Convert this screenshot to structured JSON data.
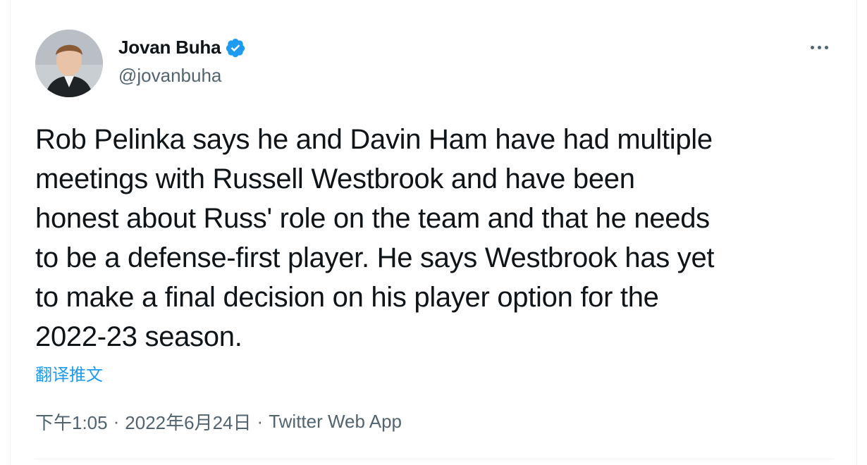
{
  "author": {
    "name": "Jovan Buha",
    "handle": "@jovanbuha",
    "verified": true
  },
  "tweet": {
    "text": "Rob Pelinka says he and Davin Ham have had multiple\nmeetings with Russell Westbrook and have been\nhonest about Russ' role on the team and that he needs\nto be a defense-first player. He says Westbrook has yet\nto make a final decision on his player option for the\n2022-23 season.",
    "translate_label": "翻译推文",
    "time": "下午1:05",
    "date": "2022年6月24日",
    "source": "Twitter Web App",
    "separator": "·"
  },
  "icons": {
    "more": "more-options-icon",
    "verified": "verified-badge-icon",
    "avatar": "avatar"
  },
  "colors": {
    "accent": "#1d9bf0",
    "text": "#0f1419",
    "secondary": "#536471"
  }
}
